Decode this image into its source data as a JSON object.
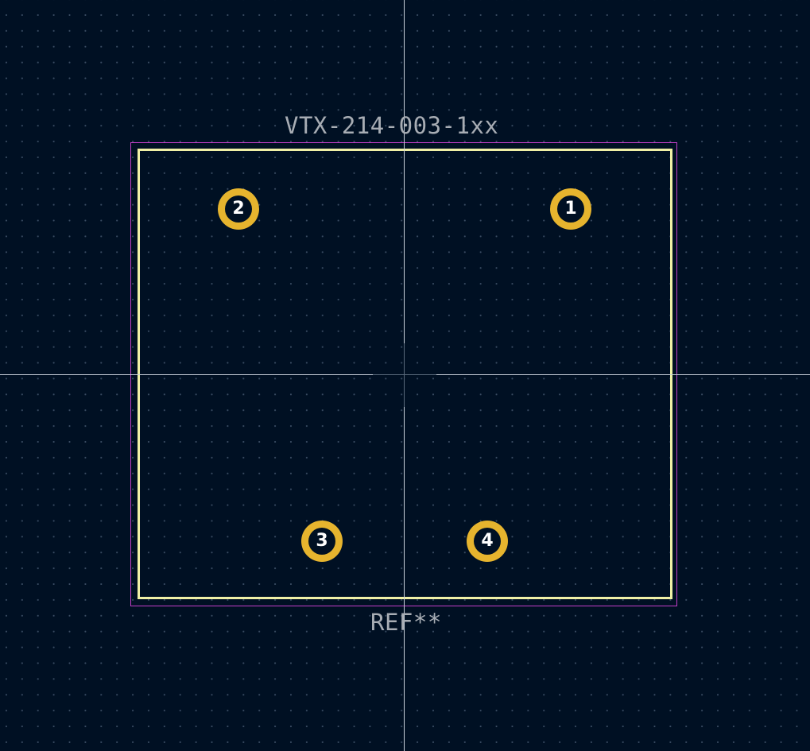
{
  "footprint": {
    "value": "VTX-214-003-1xx",
    "reference": "REF**"
  },
  "pads": [
    {
      "number": "1"
    },
    {
      "number": "2"
    },
    {
      "number": "3"
    },
    {
      "number": "4"
    }
  ],
  "colors": {
    "background": "#001023",
    "grid_dot": "#3a4c63",
    "silkscreen": "#f0f0a6",
    "courtyard": "#c23fc7",
    "pad_copper": "#e6b42e",
    "text": "#a8adb4",
    "crosshair": "#c9d0da"
  }
}
